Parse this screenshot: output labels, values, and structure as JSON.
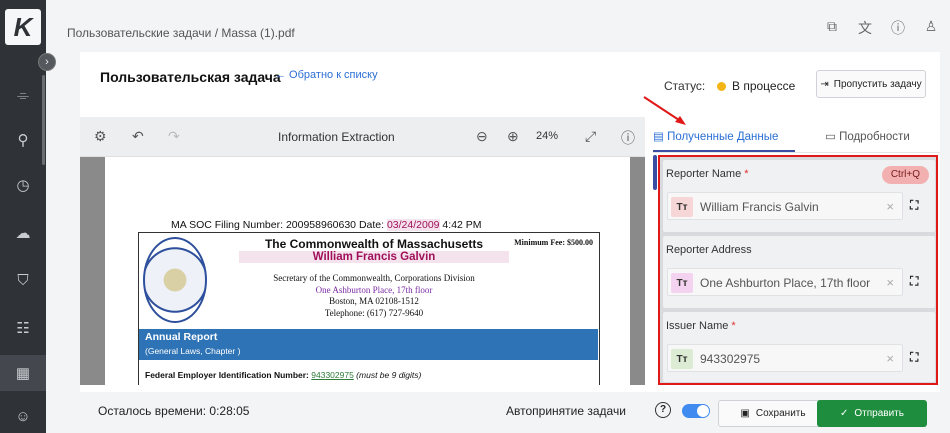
{
  "app": {
    "logo_letter": "K"
  },
  "nav": {
    "items": [
      {
        "icon": "workflow-icon",
        "glyph": "⌯"
      },
      {
        "icon": "hierarchy-icon",
        "glyph": "⚲"
      },
      {
        "icon": "clock-icon",
        "glyph": "◷"
      },
      {
        "icon": "cloud-icon",
        "glyph": "☁"
      },
      {
        "icon": "shield-icon",
        "glyph": "⛉"
      },
      {
        "icon": "tasks-icon",
        "glyph": "☷"
      },
      {
        "icon": "grid-icon",
        "glyph": "▦"
      },
      {
        "icon": "bot-icon",
        "glyph": "☺"
      }
    ]
  },
  "breadcrumb": "Пользовательские задачи / Massa (1).pdf",
  "task": {
    "title": "Пользовательская задача",
    "back_link": "← Обратно к списку",
    "status_label": "Статус:",
    "status_value": "В процессе",
    "status_color": "#f3b515",
    "skip_label": "Пропустить задачу"
  },
  "viewer": {
    "title": "Information Extraction",
    "zoom": "24%"
  },
  "document": {
    "filing_prefix": "MA SOC   Filing Number: 200958960630   Date: ",
    "filing_date": "03/24/2009",
    "filing_time": " 4:42 PM",
    "cert_title": "The Commonwealth of Massachusetts",
    "cert_name": "William Francis Galvin",
    "min_fee": "Minimum Fee: $500.00",
    "secretary_line": "Secretary of the Commonwealth, Corporations Division",
    "address_line": "One Ashburton Place, 17th floor",
    "city_line": "Boston, MA 02108-1512",
    "phone_line": "Telephone: (617) 727-9640",
    "annual_title": "Annual Report",
    "annual_sub": "(General Laws, Chapter )",
    "ein_label": "Federal Employer Identification Number: ",
    "ein_value": "943302975",
    "ein_note": " (must be 9 digits)"
  },
  "tabs": [
    {
      "label": "Полученные Данные",
      "active": true
    },
    {
      "label": "Подробности",
      "active": false
    }
  ],
  "fields": [
    {
      "label": "Reporter Name",
      "required": "*",
      "hotkey": "Ctrl+Q",
      "type": "Tт",
      "value": "William Francis Galvin",
      "badge_color": "#f6d6d6"
    },
    {
      "label": "Reporter Address",
      "required": "",
      "hotkey": "",
      "type": "Tт",
      "value": "One Ashburton Place, 17th floor",
      "badge_color": "#f3d3ef"
    },
    {
      "label": "Issuer Name",
      "required": "*",
      "hotkey": "",
      "type": "Tт",
      "value": "943302975",
      "badge_color": "#dcebd4"
    }
  ],
  "bottom": {
    "time_left": "Осталось времени: 0:28:05",
    "auto_accept": "Автопринятие задачи",
    "help": "?",
    "save_label": "Сохранить",
    "send_label": "Отправить"
  }
}
